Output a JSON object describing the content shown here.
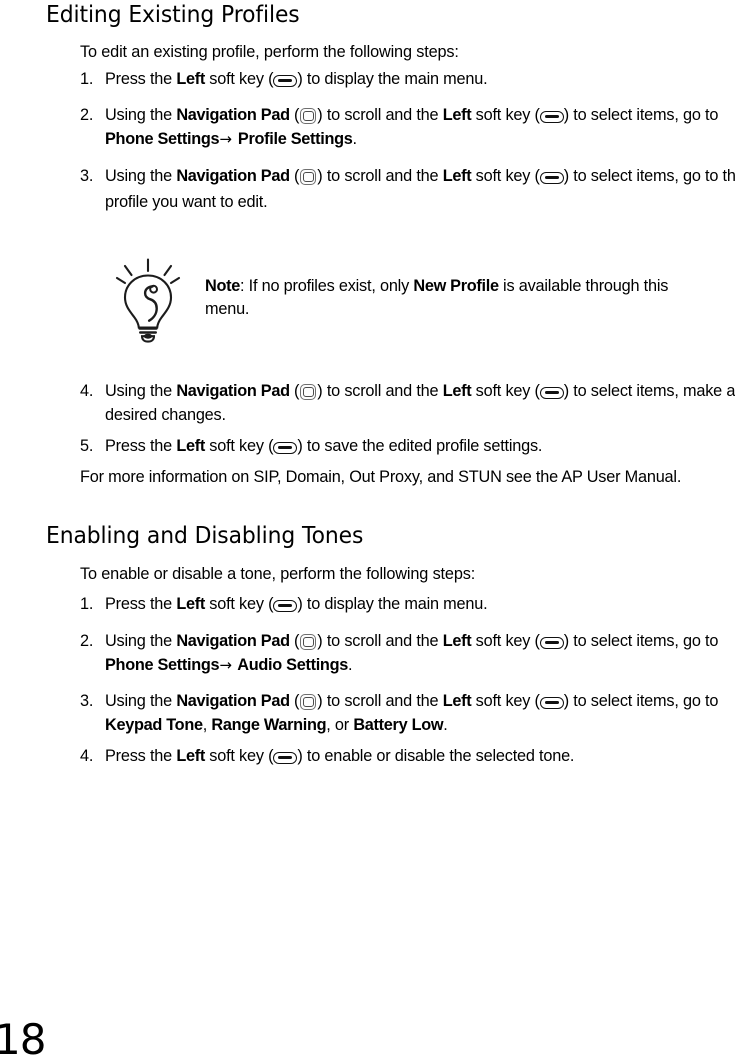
{
  "document": {
    "page_number": "18"
  },
  "sections": [
    {
      "id": "editing",
      "heading": "Editing Existing Profiles",
      "intro": "To edit an existing profile, perform the following steps:",
      "steps": [
        {
          "num": "1.",
          "parts": [
            {
              "t": "text",
              "v": "Press the "
            },
            {
              "t": "bold",
              "v": "Left"
            },
            {
              "t": "text",
              "v": " soft key ("
            },
            {
              "t": "icon",
              "v": "softkey-icon"
            },
            {
              "t": "text",
              "v": ") to display the main menu."
            }
          ]
        },
        {
          "num": "2.",
          "parts": [
            {
              "t": "text",
              "v": "Using the "
            },
            {
              "t": "bold",
              "v": "Navigation Pad"
            },
            {
              "t": "text",
              "v": " ("
            },
            {
              "t": "icon",
              "v": "navigation-pad-icon"
            },
            {
              "t": "text",
              "v": ") to scroll and the "
            },
            {
              "t": "bold",
              "v": "Left"
            },
            {
              "t": "text",
              "v": " soft key ("
            },
            {
              "t": "icon",
              "v": "softkey-icon"
            },
            {
              "t": "text",
              "v": ") to select items, go to "
            },
            {
              "t": "bold",
              "v": "Phone Settings"
            },
            {
              "t": "arrow",
              "v": "→"
            },
            {
              "t": "bold",
              "v": " Profile Settings"
            },
            {
              "t": "text",
              "v": "."
            }
          ]
        },
        {
          "num": "3.",
          "parts": [
            {
              "t": "text",
              "v": "Using the "
            },
            {
              "t": "bold",
              "v": "Navigation Pad"
            },
            {
              "t": "text",
              "v": " ("
            },
            {
              "t": "icon",
              "v": "navigation-pad-icon"
            },
            {
              "t": "text",
              "v": ") to scroll and the "
            },
            {
              "t": "bold",
              "v": "Left"
            },
            {
              "t": "text",
              "v": " soft key ("
            },
            {
              "t": "icon",
              "v": "softkey-icon"
            },
            {
              "t": "text",
              "v": ") to select items, go to the profile you want to edit."
            }
          ]
        }
      ],
      "note": {
        "icon": "lightbulb-icon",
        "parts": [
          {
            "t": "bold",
            "v": "Note"
          },
          {
            "t": "text",
            "v": ": If no profiles exist, only "
          },
          {
            "t": "bold",
            "v": "New Profile"
          },
          {
            "t": "text",
            "v": " is available through this menu."
          }
        ]
      },
      "steps_after_note": [
        {
          "num": "4.",
          "parts": [
            {
              "t": "text",
              "v": "Using the "
            },
            {
              "t": "bold",
              "v": "Navigation Pad"
            },
            {
              "t": "text",
              "v": " ("
            },
            {
              "t": "icon",
              "v": "navigation-pad-icon"
            },
            {
              "t": "text",
              "v": ") to scroll and the "
            },
            {
              "t": "bold",
              "v": "Left"
            },
            {
              "t": "text",
              "v": " soft key ("
            },
            {
              "t": "icon",
              "v": "softkey-icon"
            },
            {
              "t": "text",
              "v": ") to select items, make any desired changes."
            }
          ]
        },
        {
          "num": "5.",
          "parts": [
            {
              "t": "text",
              "v": "Press the "
            },
            {
              "t": "bold",
              "v": "Left"
            },
            {
              "t": "text",
              "v": " soft key ("
            },
            {
              "t": "icon",
              "v": "softkey-icon"
            },
            {
              "t": "text",
              "v": ") to save the edited profile settings."
            }
          ]
        }
      ],
      "closing_paragraph": "For more information on SIP, Domain, Out Proxy, and STUN see the AP User Manual."
    },
    {
      "id": "tones",
      "heading": "Enabling and Disabling Tones",
      "intro": "To enable or disable a tone, perform the following steps:",
      "steps": [
        {
          "num": "1.",
          "parts": [
            {
              "t": "text",
              "v": "Press the "
            },
            {
              "t": "bold",
              "v": "Left"
            },
            {
              "t": "text",
              "v": " soft key ("
            },
            {
              "t": "icon",
              "v": "softkey-icon"
            },
            {
              "t": "text",
              "v": ") to display the main menu."
            }
          ]
        },
        {
          "num": "2.",
          "parts": [
            {
              "t": "text",
              "v": "Using the "
            },
            {
              "t": "bold",
              "v": "Navigation Pad"
            },
            {
              "t": "text",
              "v": " ("
            },
            {
              "t": "icon",
              "v": "navigation-pad-icon"
            },
            {
              "t": "text",
              "v": ") to scroll and the "
            },
            {
              "t": "bold",
              "v": "Left"
            },
            {
              "t": "text",
              "v": " soft key ("
            },
            {
              "t": "icon",
              "v": "softkey-icon"
            },
            {
              "t": "text",
              "v": ") to select items, go to "
            },
            {
              "t": "bold",
              "v": "Phone Settings"
            },
            {
              "t": "arrow",
              "v": "→"
            },
            {
              "t": "bold",
              "v": " Audio Settings"
            },
            {
              "t": "text",
              "v": "."
            }
          ]
        },
        {
          "num": "3.",
          "parts": [
            {
              "t": "text",
              "v": "Using the "
            },
            {
              "t": "bold",
              "v": "Navigation Pad"
            },
            {
              "t": "text",
              "v": " ("
            },
            {
              "t": "icon",
              "v": "navigation-pad-icon"
            },
            {
              "t": "text",
              "v": ") to scroll and the "
            },
            {
              "t": "bold",
              "v": "Left"
            },
            {
              "t": "text",
              "v": " soft key ("
            },
            {
              "t": "icon",
              "v": "softkey-icon"
            },
            {
              "t": "text",
              "v": ") to select items, go to "
            },
            {
              "t": "bold",
              "v": "Keypad Tone"
            },
            {
              "t": "text",
              "v": ", "
            },
            {
              "t": "bold",
              "v": "Range Warning"
            },
            {
              "t": "text",
              "v": ", or "
            },
            {
              "t": "bold",
              "v": "Battery Low"
            },
            {
              "t": "text",
              "v": "."
            }
          ]
        },
        {
          "num": "4.",
          "parts": [
            {
              "t": "text",
              "v": "Press the "
            },
            {
              "t": "bold",
              "v": "Left"
            },
            {
              "t": "text",
              "v": " soft key ("
            },
            {
              "t": "icon",
              "v": "softkey-icon"
            },
            {
              "t": "text",
              "v": ") to enable or disable the selected tone."
            }
          ]
        }
      ]
    }
  ]
}
